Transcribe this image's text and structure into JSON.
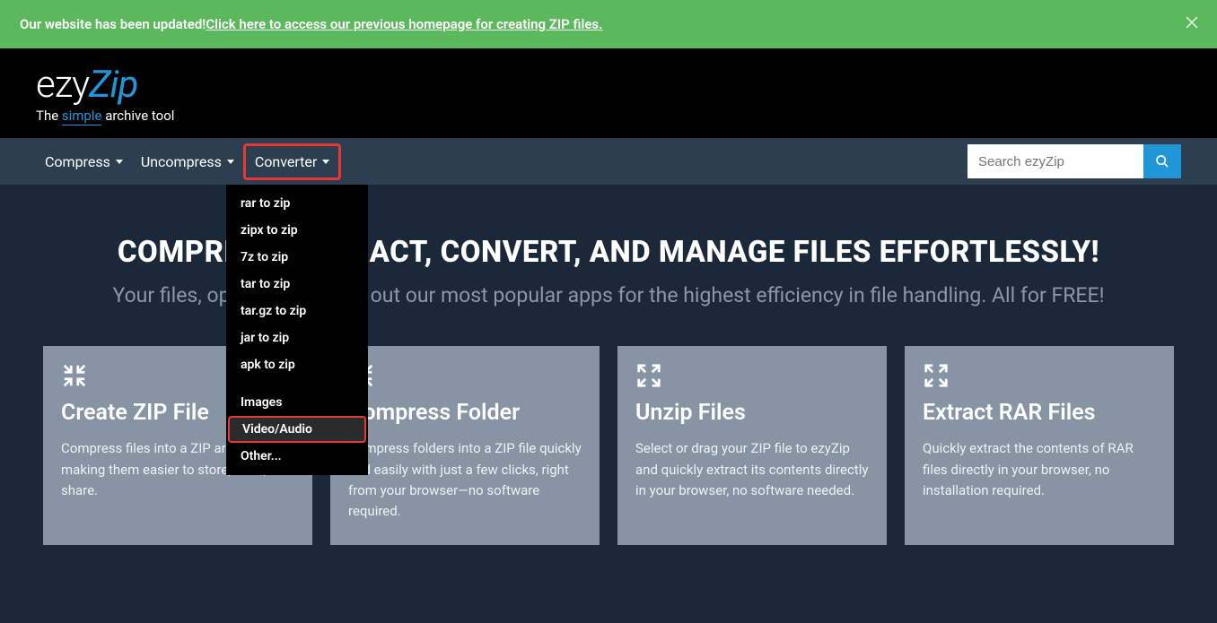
{
  "banner": {
    "text": "Our website has been updated! ",
    "link": "Click here to access our previous homepage for creating ZIP files."
  },
  "logo": {
    "p1": "ezy",
    "p2": "Zip",
    "sub_prefix": "The ",
    "sub_simple": "simple",
    "sub_suffix": " archive tool"
  },
  "nav": {
    "compress": "Compress",
    "uncompress": "Uncompress",
    "converter": "Converter"
  },
  "search": {
    "placeholder": "Search ezyZip"
  },
  "dropdown": {
    "items": [
      "rar to zip",
      "zipx to zip",
      "7z to zip",
      "tar to zip",
      "tar.gz to zip",
      "jar to zip",
      "apk to zip"
    ],
    "group2": [
      "Images",
      "Video/Audio",
      "Other..."
    ],
    "hovered": "Video/Audio"
  },
  "hero": {
    "title": "COMPRESS, EXTRACT, CONVERT, AND MANAGE FILES EFFORTLESSLY!",
    "subtitle": "Your files, optimized! Check out our most popular apps for the highest efficiency in file handling. All for FREE!"
  },
  "cards": [
    {
      "title": "Create ZIP File",
      "desc": "Compress files into a ZIP archive, making them easier to store, send, and share.",
      "icon": "compress"
    },
    {
      "title": "Compress Folder",
      "desc": "Compress folders into a ZIP file quickly and easily with just a few clicks, right from your browser—no software required.",
      "icon": "compress"
    },
    {
      "title": "Unzip Files",
      "desc": "Select or drag your ZIP file to ezyZip and quickly extract its contents directly in your browser, no software needed.",
      "icon": "expand"
    },
    {
      "title": "Extract RAR Files",
      "desc": "Quickly extract the contents of RAR files directly in your browser, no installation required.",
      "icon": "expand"
    }
  ]
}
